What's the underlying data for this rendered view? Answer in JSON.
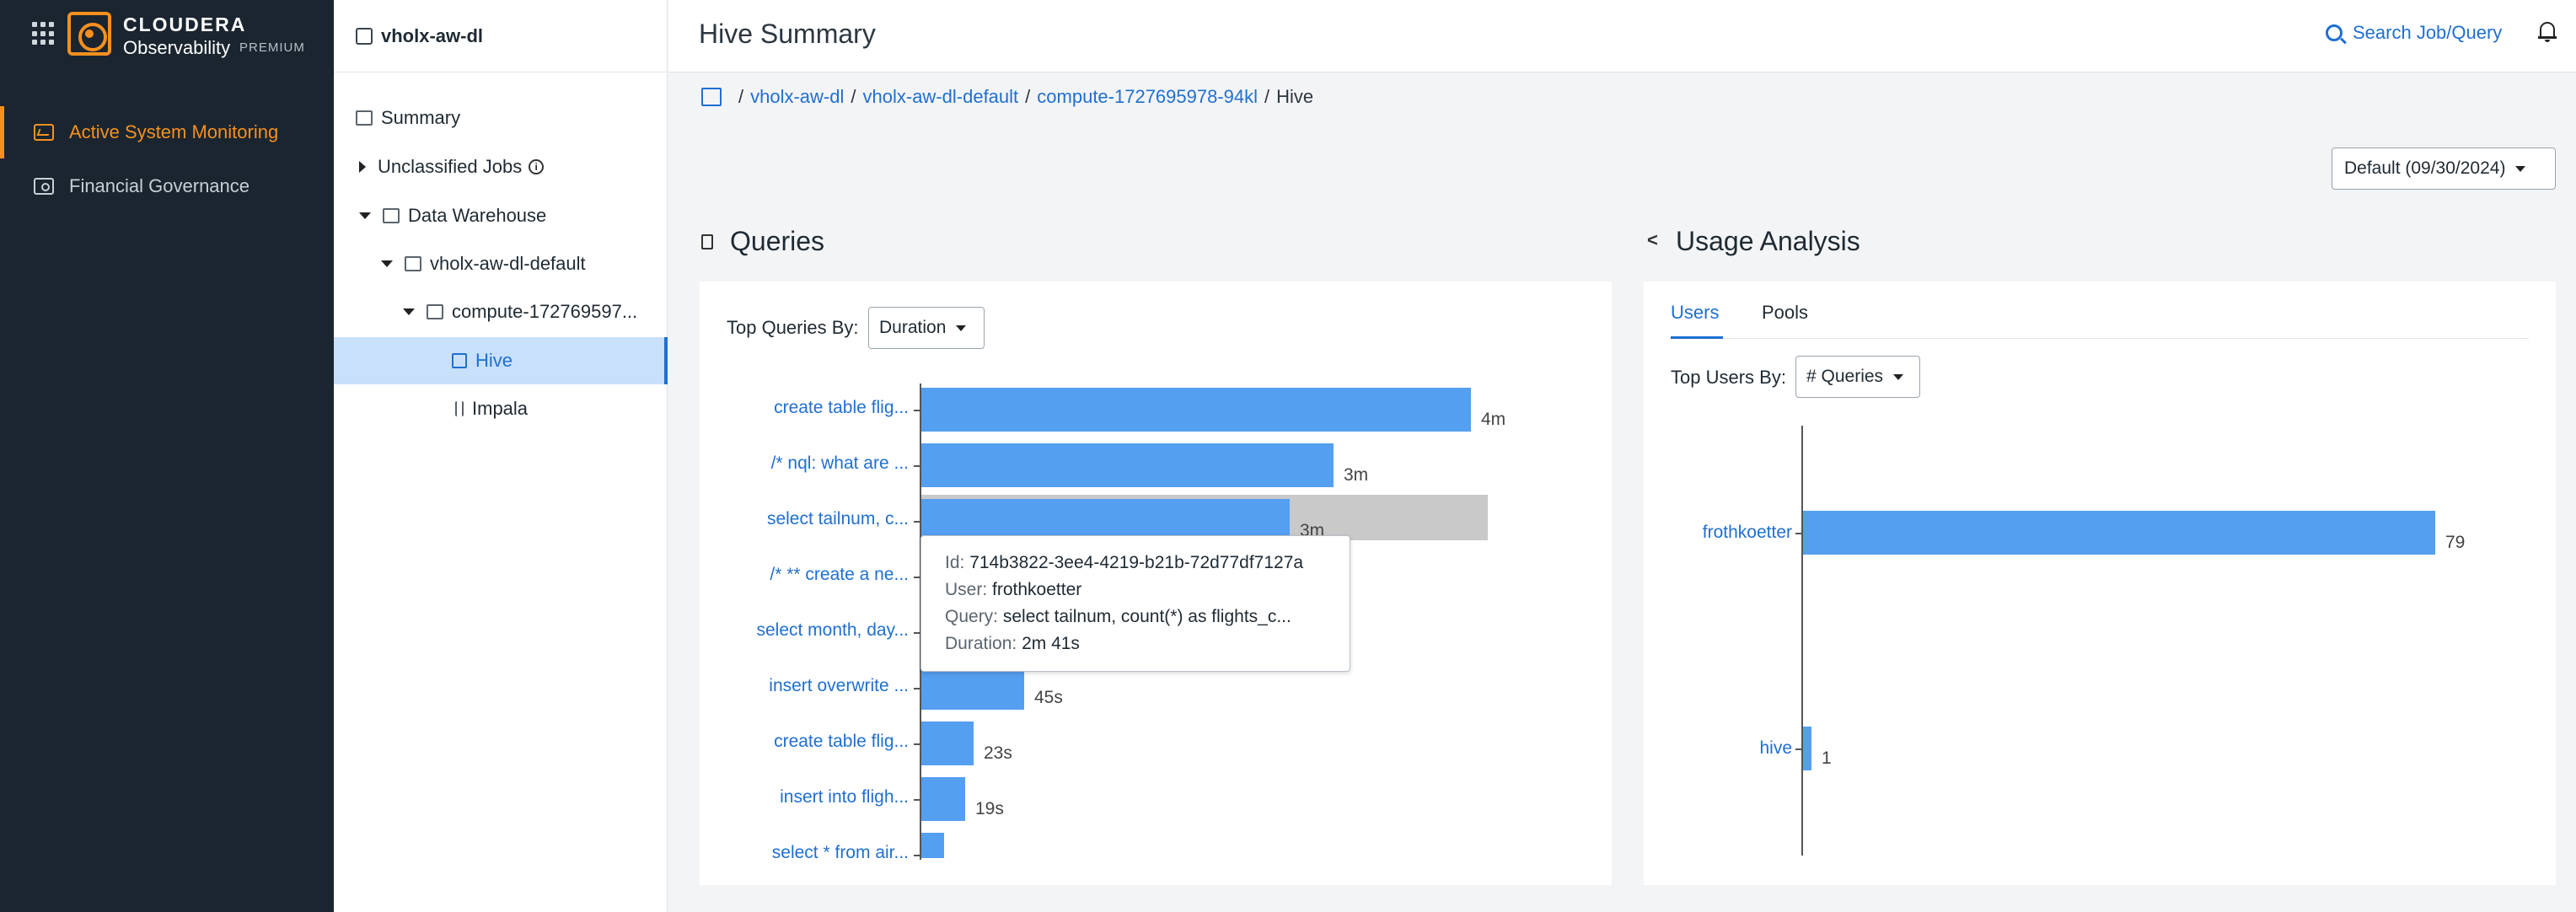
{
  "brand": {
    "name": "CLOUDERA",
    "product": "Observability",
    "tier": "PREMIUM",
    "accent": "#f7901e"
  },
  "nav": {
    "items": [
      {
        "label": "Active System Monitoring",
        "icon": "monitoring-icon",
        "active": true
      },
      {
        "label": "Financial Governance",
        "icon": "finance-icon",
        "active": false
      }
    ]
  },
  "tree": {
    "header": "vholx-aw-dl",
    "items": [
      {
        "label": "Summary"
      },
      {
        "label": "Unclassified Jobs"
      },
      {
        "label": "Data Warehouse"
      },
      {
        "label": "vholx-aw-dl-default"
      },
      {
        "label": "compute-172769597..."
      },
      {
        "label": "Hive",
        "selected": true
      },
      {
        "label": "Impala"
      }
    ]
  },
  "header": {
    "title": "Hive Summary",
    "search_label": "Search Job/Query"
  },
  "breadcrumb": [
    "vholx-aw-dl",
    "vholx-aw-dl-default",
    "compute-1727695978-94kl",
    "Hive"
  ],
  "default_select": "Default (09/30/2024)",
  "queries": {
    "title": "Queries",
    "top_by_label": "Top Queries By:",
    "top_by_value": "Duration"
  },
  "usage": {
    "title": "Usage Analysis",
    "tabs": [
      "Users",
      "Pools"
    ],
    "top_by_label": "Top Users By:",
    "top_by_value": "# Queries"
  },
  "tooltip": {
    "id_key": "Id:",
    "id": "714b3822-3ee4-4219-b21b-72d77df7127a",
    "user_key": "User:",
    "user": "frothkoetter",
    "query_key": "Query:",
    "query": "select tailnum, count(*) as flights_c...",
    "duration_key": "Duration:",
    "duration": "2m 41s"
  },
  "chart_data": [
    {
      "type": "bar",
      "orientation": "horizontal",
      "title": "Queries",
      "categories": [
        "create table flig...",
        "/* nql: what are ...",
        "select tailnum, c...",
        "/* ** create a ne...",
        "select month, day...",
        "insert overwrite ...",
        "create table flig...",
        "insert into fligh...",
        "select * from air..."
      ],
      "values_seconds": [
        240,
        180,
        161,
        null,
        null,
        45,
        23,
        19,
        10
      ],
      "value_labels": [
        "4m",
        "3m",
        "3m",
        "",
        "",
        "45s",
        "23s",
        "19s",
        ""
      ],
      "highlighted_index": 2
    },
    {
      "type": "bar",
      "orientation": "horizontal",
      "title": "Usage Analysis",
      "categories": [
        "frothkoetter",
        "hive"
      ],
      "values": [
        79,
        1
      ],
      "value_labels": [
        "79",
        "1"
      ]
    }
  ],
  "colors": {
    "bar": "#549ff0",
    "link": "#1f6fd1",
    "nav_bg": "#1a2530",
    "highlight": "#c9c9c9"
  }
}
